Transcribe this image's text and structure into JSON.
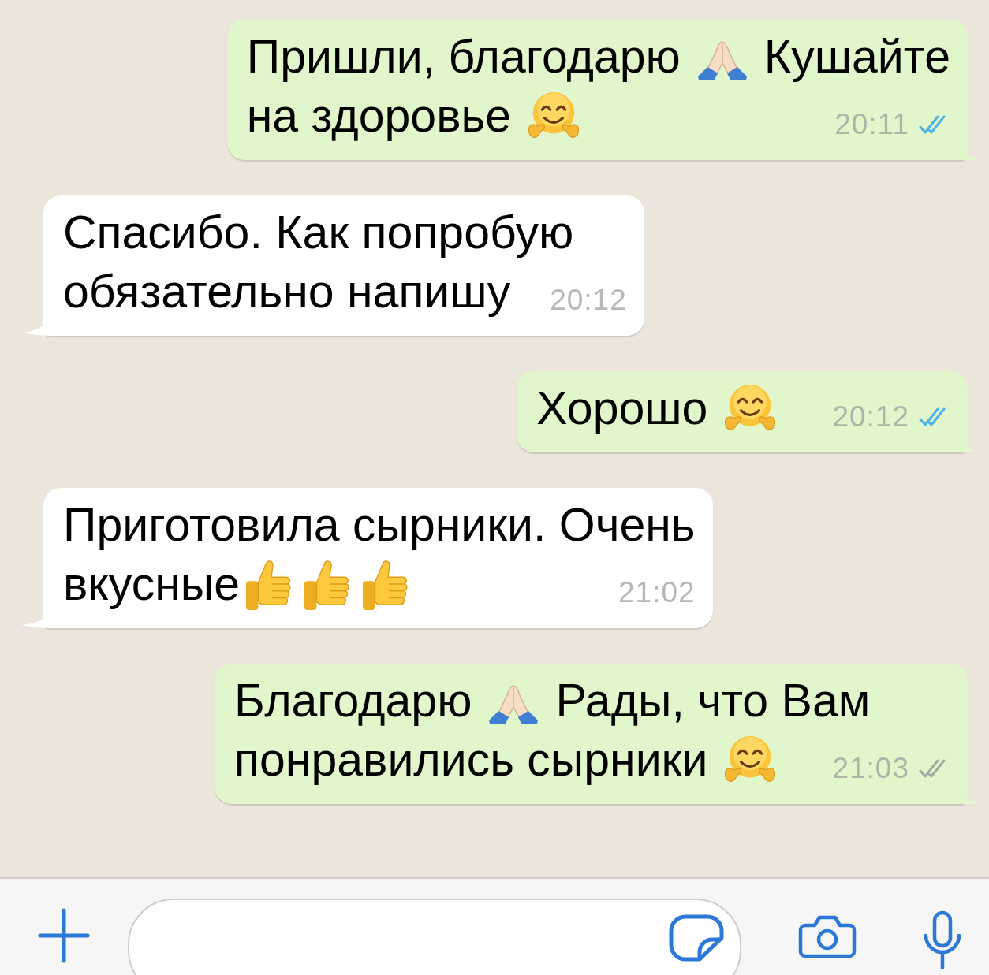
{
  "messages": [
    {
      "kind": "outgoing",
      "lines": [
        {
          "parts": [
            {
              "kind": "text",
              "text": "Пришли, благодарю"
            },
            {
              "kind": "pray"
            },
            {
              "kind": "text",
              "text": "Кушайте"
            }
          ]
        },
        {
          "parts": [
            {
              "kind": "text",
              "text": "на здоровье"
            },
            {
              "kind": "hug"
            }
          ]
        }
      ],
      "time": "20:11",
      "read": true
    },
    {
      "kind": "incoming",
      "lines": [
        {
          "parts": [
            {
              "kind": "text",
              "text": "Спасибо. Как попробую"
            }
          ]
        },
        {
          "parts": [
            {
              "kind": "text",
              "text": "обязательно напишу"
            }
          ]
        }
      ],
      "time": "20:12"
    },
    {
      "kind": "outgoing",
      "lines": [
        {
          "parts": [
            {
              "kind": "text",
              "text": "Хорошо"
            },
            {
              "kind": "hug"
            }
          ]
        }
      ],
      "time": "20:12",
      "read": true
    },
    {
      "kind": "incoming",
      "lines": [
        {
          "parts": [
            {
              "kind": "text",
              "text": "Приготовила сырники. Очень"
            }
          ]
        },
        {
          "parts": [
            {
              "kind": "text",
              "text": "вкусные"
            },
            {
              "kind": "thumbs"
            },
            {
              "kind": "thumbs"
            },
            {
              "kind": "thumbs"
            }
          ]
        }
      ],
      "time": "21:02"
    },
    {
      "kind": "outgoing",
      "lines": [
        {
          "parts": [
            {
              "kind": "text",
              "text": "Благодарю"
            },
            {
              "kind": "pray"
            },
            {
              "kind": "text",
              "text": "Рады, что Вам"
            }
          ]
        },
        {
          "parts": [
            {
              "kind": "text",
              "text": "понравились сырники"
            },
            {
              "kind": "hug"
            }
          ]
        }
      ],
      "time": "21:03",
      "read": false
    }
  ]
}
